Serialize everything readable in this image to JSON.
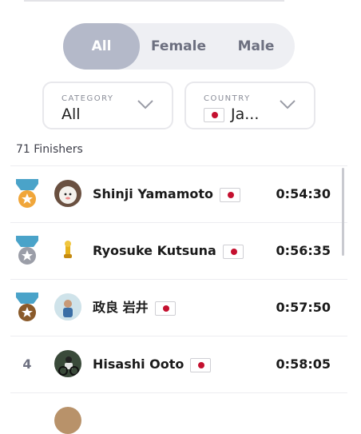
{
  "filter": {
    "options": [
      "All",
      "Female",
      "Male"
    ],
    "selected": "All"
  },
  "category": {
    "label": "CATEGORY",
    "value": "All"
  },
  "country": {
    "label": "COUNTRY",
    "value": "Ja...",
    "flag": "japan-flag"
  },
  "finishers_label": "71 Finishers",
  "results": [
    {
      "rank": "1",
      "medal": "gold-medal-icon",
      "name": "Shinji Yamamoto",
      "time": "0:54:30"
    },
    {
      "rank": "2",
      "medal": "silver-medal-icon",
      "name": "Ryosuke Kutsuna",
      "time": "0:56:35"
    },
    {
      "rank": "3",
      "medal": "bronze-medal-icon",
      "name": "政良 岩井",
      "time": "0:57:50"
    },
    {
      "rank": "4",
      "medal": "",
      "name": "Hisashi Ooto",
      "time": "0:58:05"
    }
  ],
  "colors": {
    "gold": "#f0a63a",
    "silver": "#9b9ea8",
    "bronze": "#8a5a2a",
    "ribbon": "#4aa3c9",
    "flag_red": "#c4102f"
  }
}
